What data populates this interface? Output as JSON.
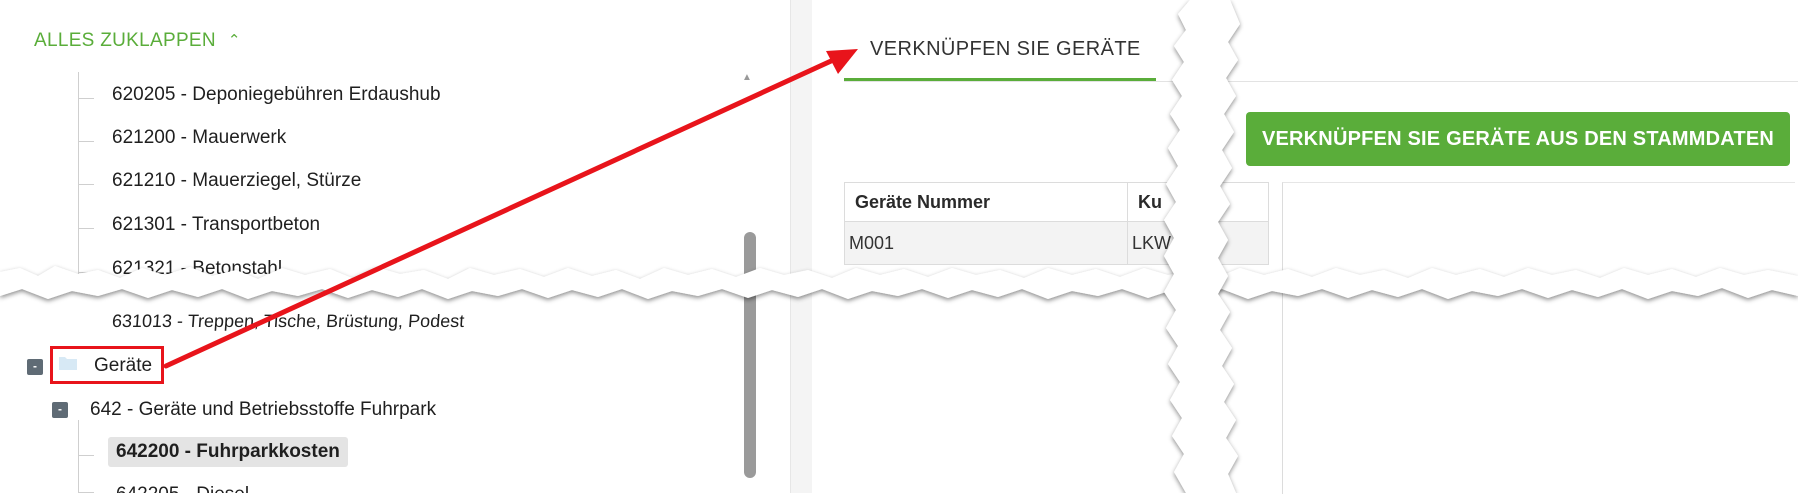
{
  "tree": {
    "collapse_all": "ALLES ZUKLAPPEN",
    "collapse_icon": "chevron-up-icon",
    "items_upper": [
      "620205 - Deponiegebühren Erdaushub",
      "621200 - Mauerwerk",
      "621210 - Mauerziegel, Stürze",
      "621301 - Transportbeton",
      "621321 - Betonstahl"
    ],
    "partial_item": "631013 - Treppen, Tische, Brüstung, Podest",
    "folder_label": "Geräte",
    "folder_icon": "folder-icon",
    "subgroup": "642 - Geräte und Betriebsstoffe Fuhrpark",
    "selected_item": "642200 - Fuhrparkkosten",
    "cut_item": "642205 - Diesel",
    "toggle_symbol": "-"
  },
  "right": {
    "tab_label": "VERKNÜPFEN SIE GERÄTE",
    "button_label": "VERKNÜPFEN SIE GERÄTE AUS DEN STAMMDATEN",
    "table": {
      "headers": [
        "Geräte Nummer",
        "Ku"
      ],
      "rows": [
        [
          "M001",
          "LKW"
        ]
      ]
    }
  },
  "colors": {
    "accent_green": "#5aad3a",
    "highlight_red": "#e8141b",
    "toggle_gray": "#5f6b75"
  }
}
